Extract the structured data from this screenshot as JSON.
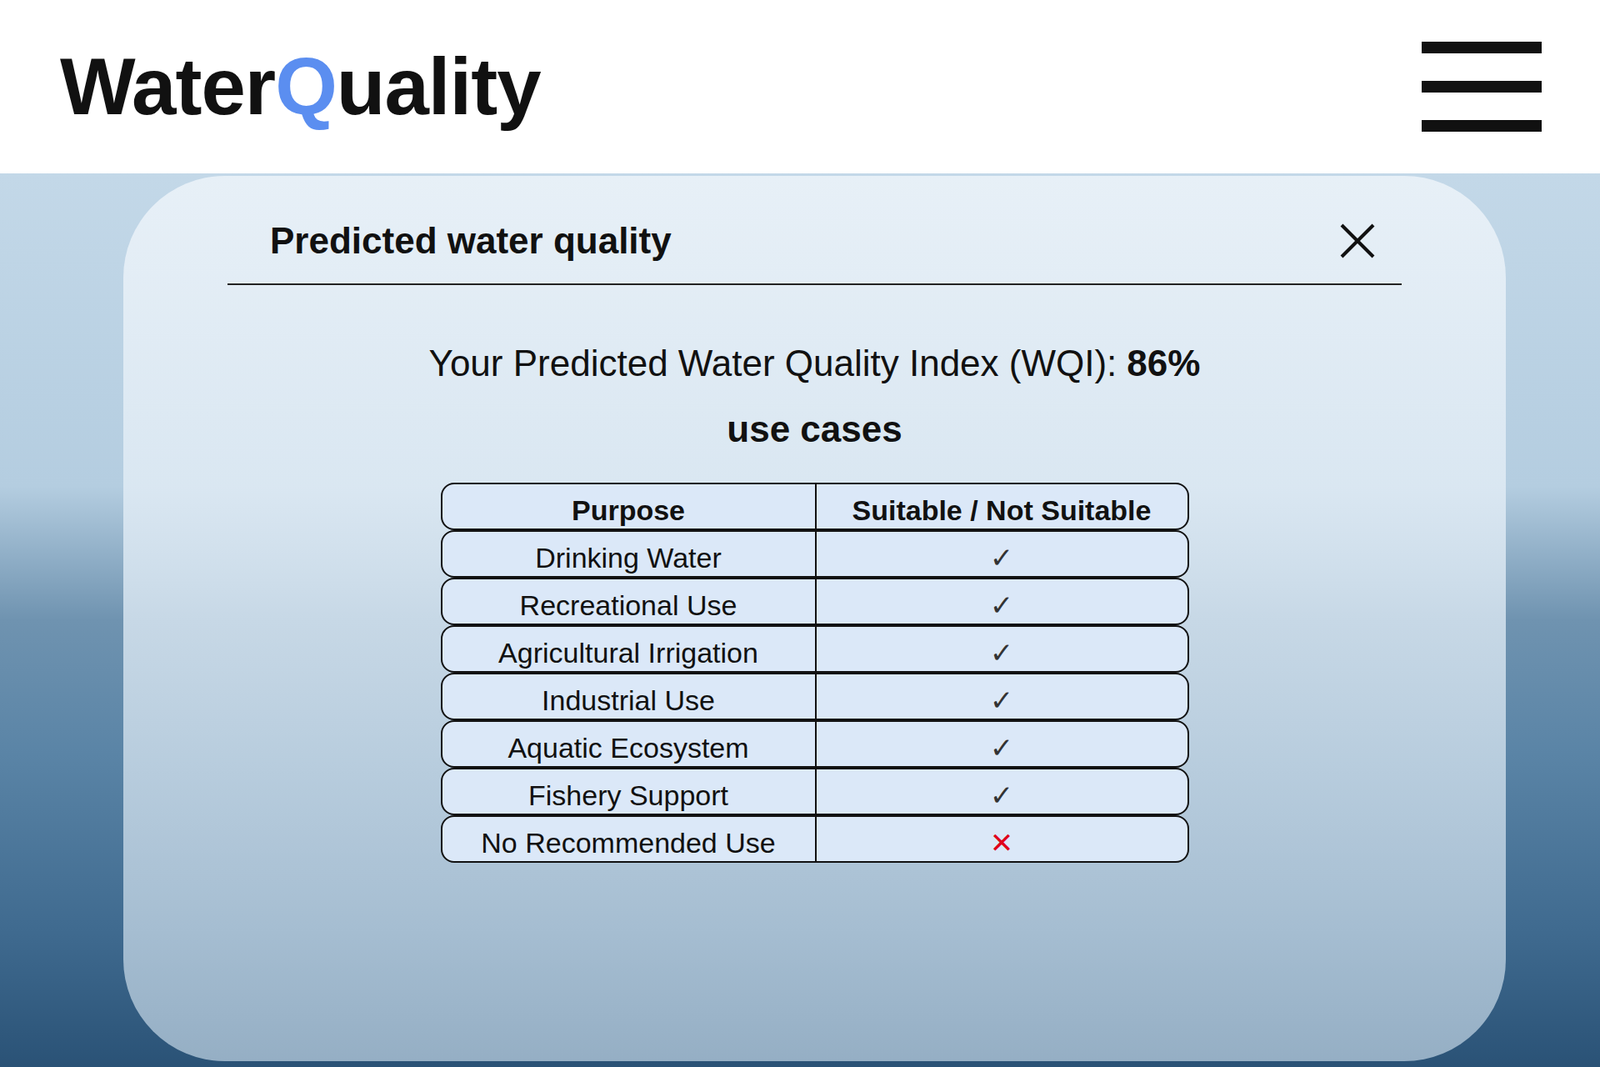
{
  "header": {
    "logo": [
      {
        "text": "Water",
        "accent": false
      },
      {
        "text": "Q",
        "accent": true
      },
      {
        "text": "uality",
        "accent": false
      }
    ]
  },
  "dialog": {
    "title": "Predicted water quality",
    "wqi": {
      "label": "Your Predicted Water Quality Index (WQI):",
      "value": "86%"
    },
    "subtitle": "use cases",
    "table": {
      "columns": [
        "Purpose",
        "Suitable / Not Suitable"
      ],
      "rows": [
        {
          "purpose": "Drinking Water",
          "mark": "✓",
          "suitable": true
        },
        {
          "purpose": "Recreational Use",
          "mark": "✓",
          "suitable": true
        },
        {
          "purpose": "Agricultural Irrigation",
          "mark": "✓",
          "suitable": true
        },
        {
          "purpose": "Industrial Use",
          "mark": "✓",
          "suitable": true
        },
        {
          "purpose": "Aquatic Ecosystem",
          "mark": "✓",
          "suitable": true
        },
        {
          "purpose": "Fishery Support",
          "mark": "✓",
          "suitable": true
        },
        {
          "purpose": "No Recommended Use",
          "mark": "✕",
          "suitable": false
        }
      ]
    }
  }
}
